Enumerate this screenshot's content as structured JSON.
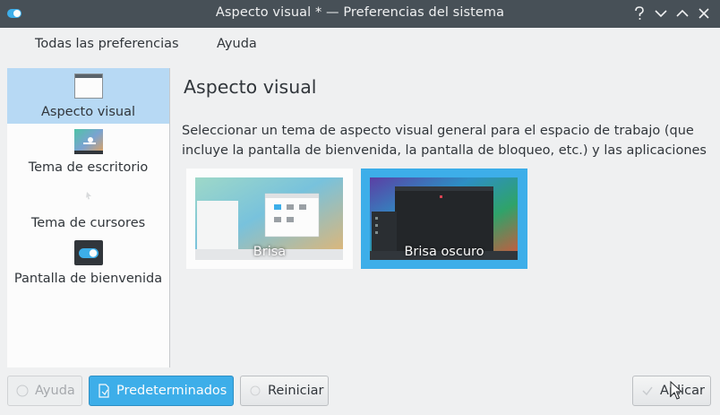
{
  "window": {
    "title": "Aspecto visual * — Preferencias del sistema"
  },
  "toolbar": {
    "all_prefs": "Todas las preferencias",
    "help": "Ayuda"
  },
  "sidebar": {
    "items": [
      {
        "label": "Aspecto visual",
        "icon": "window-icon",
        "selected": true
      },
      {
        "label": "Tema de escritorio",
        "icon": "desktop-theme-icon",
        "selected": false
      },
      {
        "label": "Tema de cursores",
        "icon": "cursor-icon",
        "selected": false
      },
      {
        "label": "Pantalla de bienvenida",
        "icon": "toggle-icon",
        "selected": false
      }
    ]
  },
  "main": {
    "title": "Aspecto visual",
    "description": "Seleccionar un tema de aspecto visual general para el espacio de trabajo (que incluye la pantalla de bienvenida, la pantalla de bloqueo, etc.) y las aplicaciones",
    "themes": [
      {
        "label": "Brisa",
        "selected": false
      },
      {
        "label": "Brisa oscuro",
        "selected": true
      }
    ]
  },
  "buttons": {
    "help": "Ayuda",
    "defaults": "Predeterminados",
    "reset": "Reiniciar",
    "apply": "Aplicar"
  },
  "colors": {
    "accent": "#3daee9",
    "titlebar": "#475057",
    "selection": "#b7d9f4"
  }
}
